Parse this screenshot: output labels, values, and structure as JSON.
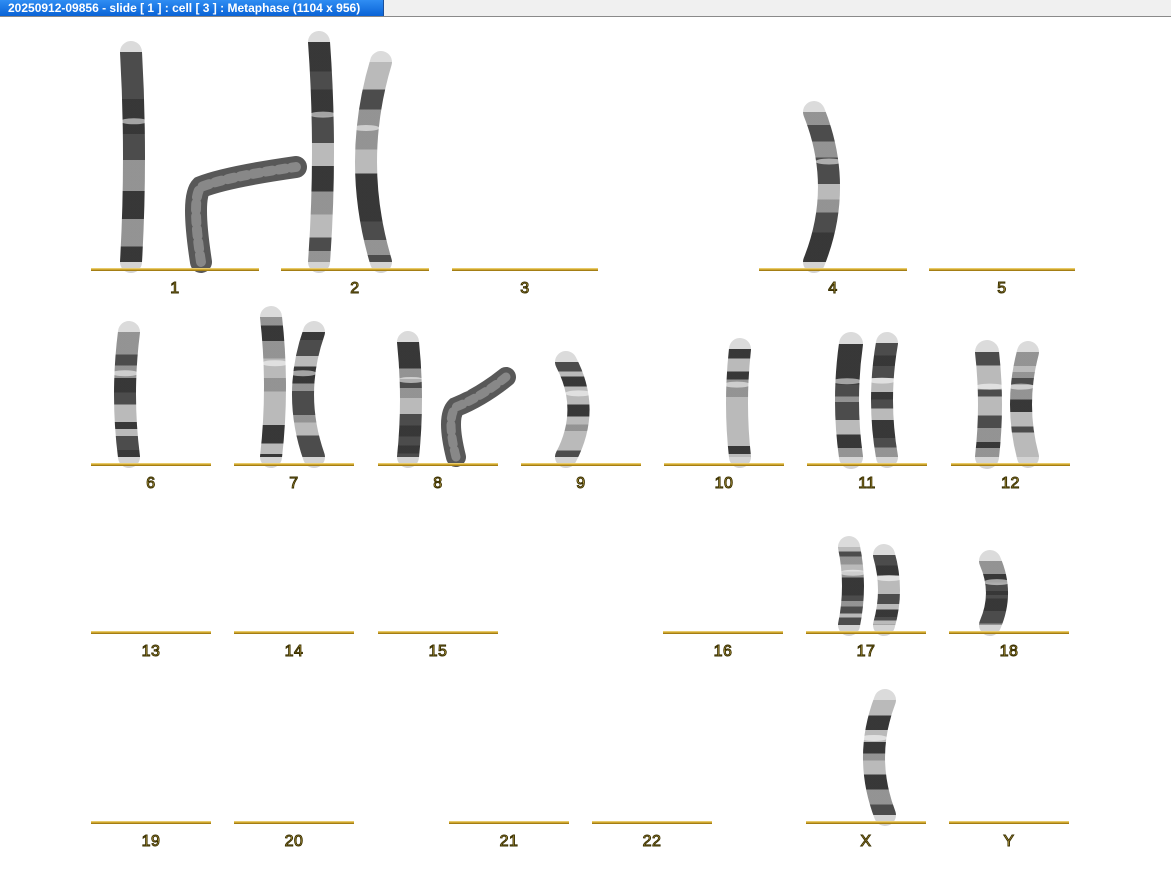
{
  "window": {
    "title": "20250912-09856 - slide [ 1 ] : cell [ 3 ] : Metaphase (1104 x 956)"
  },
  "colors": {
    "baseline": "#c79a1c",
    "label_fill": "#f0d060",
    "title_bar": "#0a63d6"
  },
  "karyogram": {
    "chromosomes": [
      {
        "id": "1",
        "label": "1"
      },
      {
        "id": "2",
        "label": "2"
      },
      {
        "id": "3",
        "label": "3"
      },
      {
        "id": "4",
        "label": "4"
      },
      {
        "id": "5",
        "label": "5"
      },
      {
        "id": "6",
        "label": "6"
      },
      {
        "id": "7",
        "label": "7"
      },
      {
        "id": "8",
        "label": "8"
      },
      {
        "id": "9",
        "label": "9"
      },
      {
        "id": "10",
        "label": "10"
      },
      {
        "id": "11",
        "label": "11"
      },
      {
        "id": "12",
        "label": "12"
      },
      {
        "id": "13",
        "label": "13"
      },
      {
        "id": "14",
        "label": "14"
      },
      {
        "id": "15",
        "label": "15"
      },
      {
        "id": "16",
        "label": "16"
      },
      {
        "id": "17",
        "label": "17"
      },
      {
        "id": "18",
        "label": "18"
      },
      {
        "id": "19",
        "label": "19"
      },
      {
        "id": "20",
        "label": "20"
      },
      {
        "id": "21",
        "label": "21"
      },
      {
        "id": "22",
        "label": "22"
      },
      {
        "id": "X",
        "label": "X"
      },
      {
        "id": "Y",
        "label": "Y"
      }
    ]
  }
}
